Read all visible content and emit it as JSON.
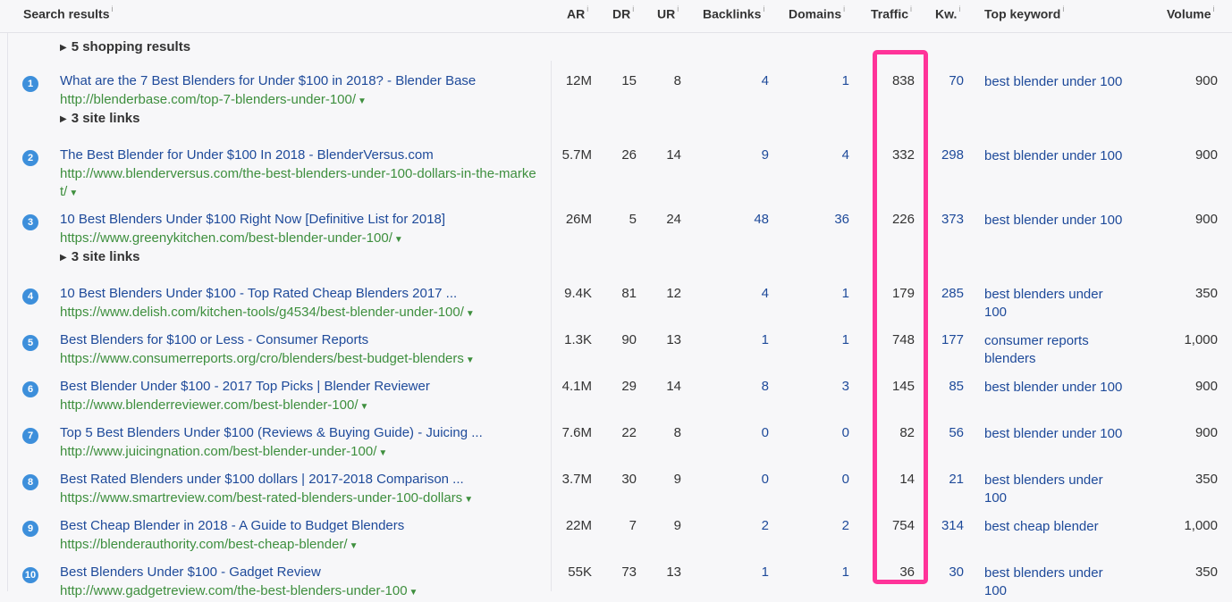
{
  "header": {
    "search_results": "Search results",
    "ar": "AR",
    "dr": "DR",
    "ur": "UR",
    "backlinks": "Backlinks",
    "domains": "Domains",
    "traffic": "Traffic",
    "kw": "Kw.",
    "top_keyword": "Top keyword",
    "volume": "Volume",
    "info": "i"
  },
  "shopping": "5 shopping results",
  "site_links": "3 site links",
  "highlight_color": "#ff3399",
  "rows": [
    {
      "rank": "1",
      "title": "What are the 7 Best Blenders for Under $100 in 2018? - Blender Base",
      "url": "http://blenderbase.com/top-7-blenders-under-100/",
      "ar": "12M",
      "dr": "15",
      "ur": "8",
      "backlinks": "4",
      "domains": "1",
      "traffic": "838",
      "kw": "70",
      "top_keyword": "best blender under 100",
      "volume": "900"
    },
    {
      "rank": "2",
      "title": "The Best Blender for Under $100 In 2018 - BlenderVersus.com",
      "url": "http://www.blenderversus.com/the-best-blenders-under-100-dollars-in-the-market/",
      "ar": "5.7M",
      "dr": "26",
      "ur": "14",
      "backlinks": "9",
      "domains": "4",
      "traffic": "332",
      "kw": "298",
      "top_keyword": "best blender under 100",
      "volume": "900"
    },
    {
      "rank": "3",
      "title": "10 Best Blenders Under $100 Right Now [Definitive List for 2018]",
      "url": "https://www.greenykitchen.com/best-blender-under-100/",
      "ar": "26M",
      "dr": "5",
      "ur": "24",
      "backlinks": "48",
      "domains": "36",
      "traffic": "226",
      "kw": "373",
      "top_keyword": "best blender under 100",
      "volume": "900"
    },
    {
      "rank": "4",
      "title": "10 Best Blenders Under $100 - Top Rated Cheap Blenders 2017 ...",
      "url": "https://www.delish.com/kitchen-tools/g4534/best-blender-under-100/",
      "ar": "9.4K",
      "dr": "81",
      "ur": "12",
      "backlinks": "4",
      "domains": "1",
      "traffic": "179",
      "kw": "285",
      "top_keyword": "best blenders under 100",
      "volume": "350"
    },
    {
      "rank": "5",
      "title": "Best Blenders for $100 or Less - Consumer Reports",
      "url": "https://www.consumerreports.org/cro/blenders/best-budget-blenders",
      "ar": "1.3K",
      "dr": "90",
      "ur": "13",
      "backlinks": "1",
      "domains": "1",
      "traffic": "748",
      "kw": "177",
      "top_keyword": "consumer reports blenders",
      "volume": "1,000"
    },
    {
      "rank": "6",
      "title": "Best Blender Under $100 - 2017 Top Picks | Blender Reviewer",
      "url": "http://www.blenderreviewer.com/best-blender-100/",
      "ar": "4.1M",
      "dr": "29",
      "ur": "14",
      "backlinks": "8",
      "domains": "3",
      "traffic": "145",
      "kw": "85",
      "top_keyword": "best blender under 100",
      "volume": "900"
    },
    {
      "rank": "7",
      "title": "Top 5 Best Blenders Under $100 (Reviews & Buying Guide) - Juicing ...",
      "url": "http://www.juicingnation.com/best-blender-under-100/",
      "ar": "7.6M",
      "dr": "22",
      "ur": "8",
      "backlinks": "0",
      "domains": "0",
      "traffic": "82",
      "kw": "56",
      "top_keyword": "best blender under 100",
      "volume": "900"
    },
    {
      "rank": "8",
      "title": "Best Rated Blenders under $100 dollars | 2017-2018 Comparison ...",
      "url": "https://www.smartreview.com/best-rated-blenders-under-100-dollars",
      "ar": "3.7M",
      "dr": "30",
      "ur": "9",
      "backlinks": "0",
      "domains": "0",
      "traffic": "14",
      "kw": "21",
      "top_keyword": "best blenders under 100",
      "volume": "350"
    },
    {
      "rank": "9",
      "title": "Best Cheap Blender in 2018 - A Guide to Budget Blenders",
      "url": "https://blenderauthority.com/best-cheap-blender/",
      "ar": "22M",
      "dr": "7",
      "ur": "9",
      "backlinks": "2",
      "domains": "2",
      "traffic": "754",
      "kw": "314",
      "top_keyword": "best cheap blender",
      "volume": "1,000"
    },
    {
      "rank": "10",
      "title": "Best Blenders Under $100 - Gadget Review",
      "url": "http://www.gadgetreview.com/the-best-blenders-under-100",
      "ar": "55K",
      "dr": "73",
      "ur": "13",
      "backlinks": "1",
      "domains": "1",
      "traffic": "36",
      "kw": "30",
      "top_keyword": "best blenders under 100",
      "volume": "350"
    }
  ]
}
